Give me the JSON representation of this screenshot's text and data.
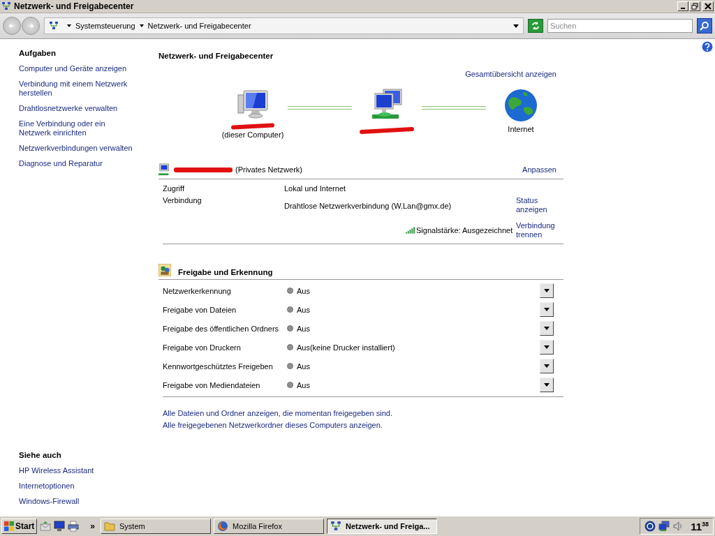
{
  "window": {
    "title": "Netzwerk- und Freigabecenter"
  },
  "address": {
    "breadcrumbs": [
      "Systemsteuerung",
      "Netzwerk- und Freigabecenter"
    ]
  },
  "search": {
    "placeholder": "Suchen"
  },
  "sidebar": {
    "tasks_heading": "Aufgaben",
    "tasks": [
      "Computer und Geräte anzeigen",
      "Verbindung mit einem Netzwerk herstellen",
      "Drahtlosnetzwerke verwalten",
      "Eine Verbindung oder ein Netzwerk einrichten",
      "Netzwerkverbindungen verwalten",
      "Diagnose und Reparatur"
    ],
    "see_also_heading": "Siehe auch",
    "see_also": [
      "HP Wireless Assistant",
      "Internetoptionen",
      "Windows-Firewall"
    ]
  },
  "main": {
    "title": "Netzwerk- und Freigabecenter",
    "map": {
      "overview_link": "Gesamtübersicht anzeigen",
      "nodes": [
        {
          "kind": "computer",
          "redacted": true,
          "label": "(dieser Computer)"
        },
        {
          "kind": "network",
          "redacted": true
        },
        {
          "kind": "internet",
          "redacted": false,
          "label": "Internet"
        }
      ]
    },
    "network": {
      "redacted": true,
      "name_suffix": "(Privates Netzwerk)",
      "customize": "Anpassen",
      "rows": [
        {
          "kind": "text",
          "label": "Zugriff",
          "value": "Lokal und Internet"
        },
        {
          "kind": "text",
          "label": "Verbindung",
          "value": "Drahtlose Netzwerkverbindung (W.Lan@gmx.de)",
          "action": "Status anzeigen"
        },
        {
          "kind": "signal",
          "value": "Signalstärke: Ausgezeichnet",
          "action": "Verbindung trennen"
        }
      ]
    },
    "sharing": {
      "title": "Freigabe und Erkennung",
      "settings": [
        {
          "label": "Netzwerkerkennung",
          "value": "Aus",
          "on": false
        },
        {
          "label": "Freigabe von Dateien",
          "value": "Aus",
          "on": false
        },
        {
          "label": "Freigabe des öffentlichen Ordners",
          "value": "Aus",
          "on": false
        },
        {
          "label": "Freigabe von Druckern",
          "value": "Aus(keine Drucker installiert)",
          "on": false
        },
        {
          "label": "Kennwortgeschütztes Freigeben",
          "value": "Aus",
          "on": false
        },
        {
          "label": "Freigabe von Mediendateien",
          "value": "Aus",
          "on": false
        }
      ],
      "links": [
        "Alle Dateien und Ordner anzeigen, die momentan freigegeben sind.",
        "Alle freigegebenen Netzwerkordner dieses Computers anzeigen."
      ]
    }
  },
  "taskbar": {
    "start": "Start",
    "chevron": "»",
    "tasks": [
      {
        "kind": "folder",
        "label": "System",
        "selected": false
      },
      {
        "kind": "browser",
        "label": "Mozilla Firefox",
        "selected": false
      },
      {
        "kind": "network",
        "label": "Netzwerk- und Freiga...",
        "selected": true
      }
    ],
    "clock": {
      "hours": "11",
      "minutes": "38"
    }
  }
}
